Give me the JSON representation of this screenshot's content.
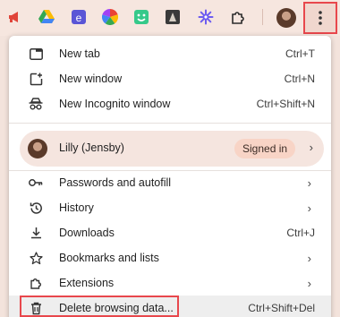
{
  "toolbar": {
    "icons": [
      "megaphone-icon",
      "google-drive-icon",
      "extension-e-icon",
      "color-wheel-icon",
      "smiley-extension-icon",
      "puzzle-dark-icon",
      "gear-flower-icon",
      "extensions-puzzle-icon"
    ],
    "menu_button_icon": "three-dots-vertical-icon"
  },
  "menu": {
    "new_tab": {
      "label": "New tab",
      "shortcut": "Ctrl+T"
    },
    "new_window": {
      "label": "New window",
      "shortcut": "Ctrl+N"
    },
    "new_incognito": {
      "label": "New Incognito window",
      "shortcut": "Ctrl+Shift+N"
    },
    "profile": {
      "name": "Lilly (Jensby)",
      "status": "Signed in"
    },
    "passwords": {
      "label": "Passwords and autofill"
    },
    "history": {
      "label": "History"
    },
    "downloads": {
      "label": "Downloads",
      "shortcut": "Ctrl+J"
    },
    "bookmarks": {
      "label": "Bookmarks and lists"
    },
    "extensions": {
      "label": "Extensions"
    },
    "delete_browsing": {
      "label": "Delete browsing data...",
      "shortcut": "Ctrl+Shift+Del"
    }
  },
  "colors": {
    "accent_highlight": "#e8474c",
    "signed_in_pill": "#f8d4c6",
    "toolbar_bg": "#f6e6df"
  }
}
